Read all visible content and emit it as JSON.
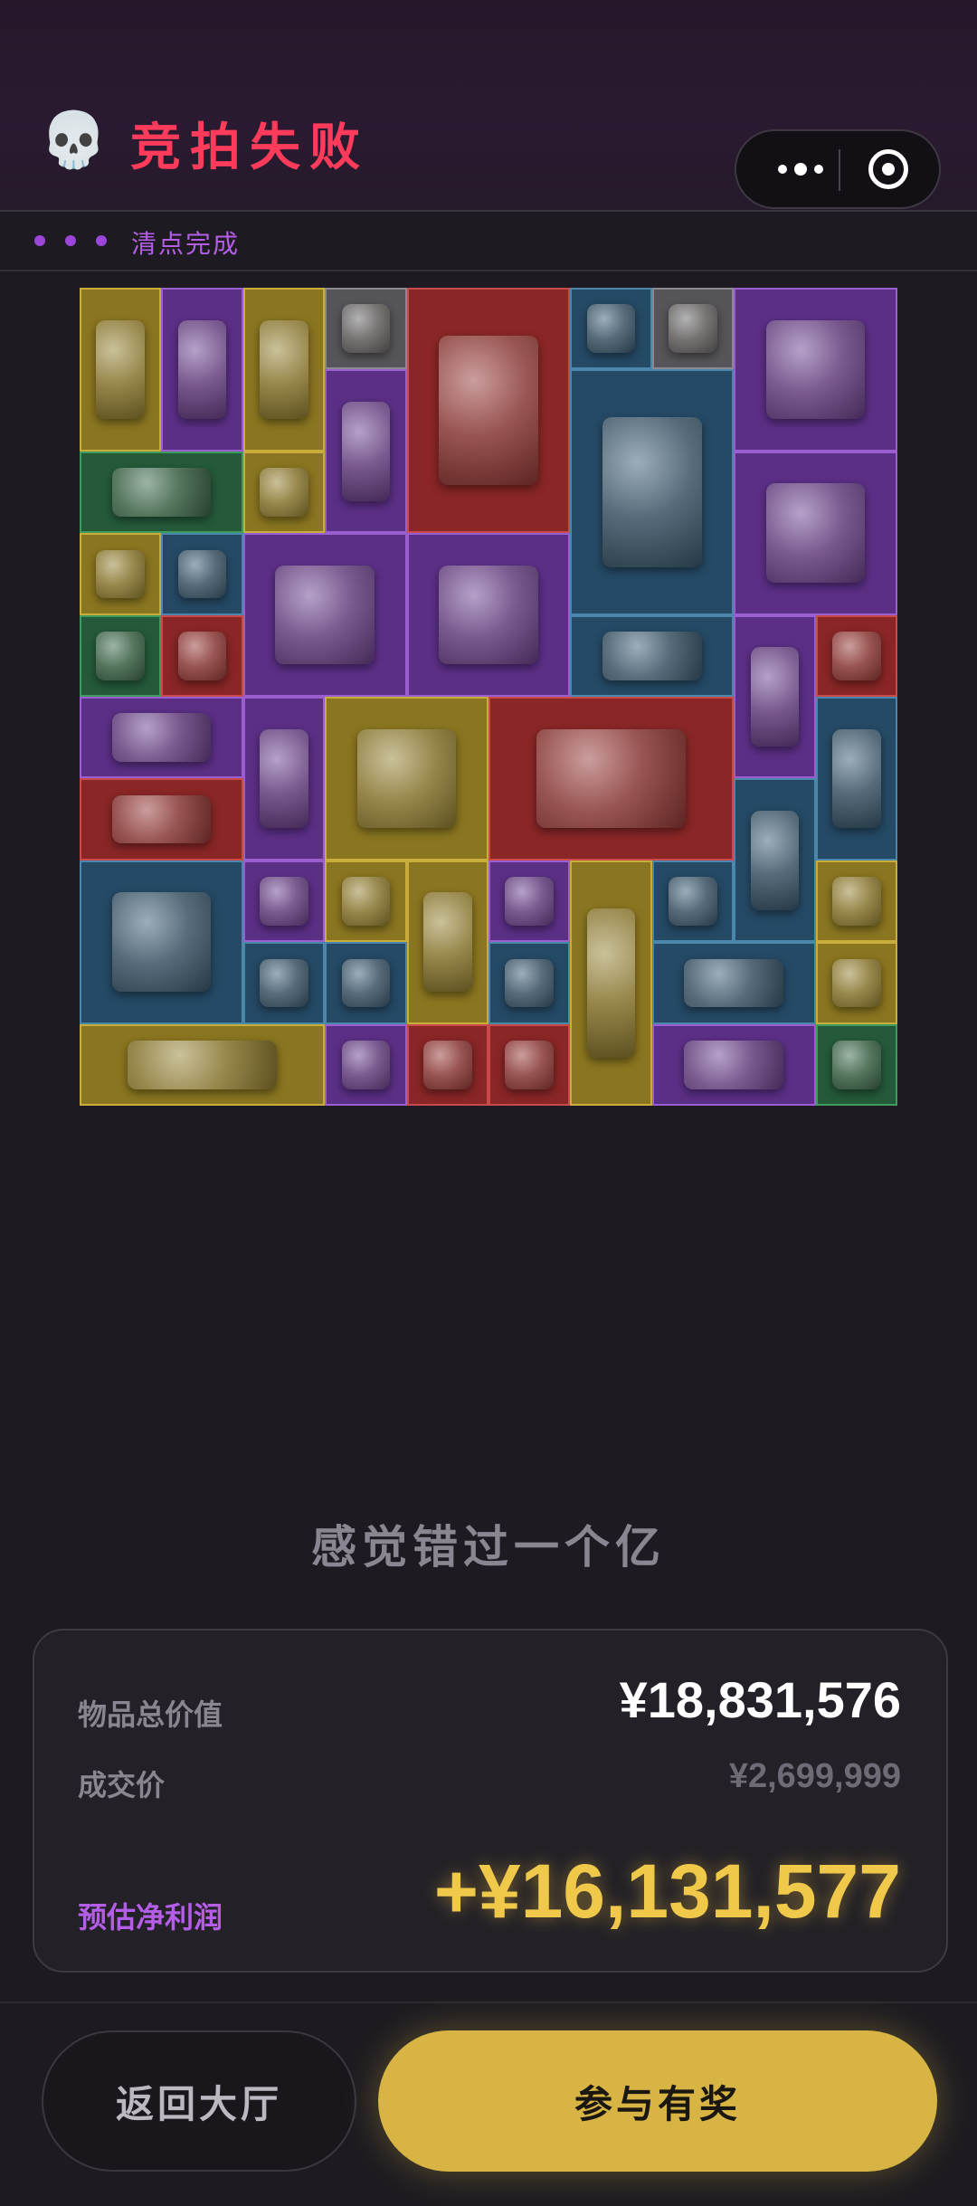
{
  "header": {
    "skull_glyph": "💀",
    "title": "竞拍失败"
  },
  "capsule": {
    "more_icon": "more-dots-icon",
    "close_icon": "target-circle-icon"
  },
  "status": {
    "text": "清点完成"
  },
  "tagline": "感觉错过一个亿",
  "summary": {
    "total_label": "物品总价值",
    "total_value": "¥18,831,576",
    "deal_label": "成交价",
    "deal_value": "¥2,699,999",
    "profit_label": "预估净利润",
    "profit_value": "+¥16,131,577"
  },
  "buttons": {
    "lobby": "返回大厅",
    "join": "参与有奖"
  },
  "colors": {
    "title": "#ff3b5c",
    "accent_purple": "#b45ee8",
    "profit_gold": "#f0c94b",
    "join_button": "#d7b443",
    "rarity_gold": "#8a7620",
    "rarity_purple": "#5b2f86",
    "rarity_blue": "#254a66",
    "rarity_red": "#8a2626",
    "rarity_gray": "#56565a",
    "rarity_green": "#245a3a"
  },
  "items": [
    {
      "name": "item-document",
      "rarity": "gold"
    },
    {
      "name": "item-golden-teapot",
      "rarity": "purple"
    },
    {
      "name": "item-coffee-machine",
      "rarity": "gold"
    },
    {
      "name": "item-playing-card",
      "rarity": "gray"
    },
    {
      "name": "item-gramophone",
      "rarity": "red"
    },
    {
      "name": "item-circuit-chip",
      "rarity": "blue"
    },
    {
      "name": "item-old-letter",
      "rarity": "gray"
    },
    {
      "name": "item-centrifuge",
      "rarity": "purple"
    },
    {
      "name": "item-golden-teapot",
      "rarity": "purple"
    },
    {
      "name": "item-cement-bag",
      "rarity": "blue"
    },
    {
      "name": "item-keyboard",
      "rarity": "green"
    },
    {
      "name": "item-lighter",
      "rarity": "gold"
    },
    {
      "name": "item-circular-saw",
      "rarity": "purple"
    },
    {
      "name": "item-trophy",
      "rarity": "gold"
    },
    {
      "name": "item-power-adapter",
      "rarity": "blue"
    },
    {
      "name": "item-incubator",
      "rarity": "purple"
    },
    {
      "name": "item-centrifuge",
      "rarity": "purple"
    },
    {
      "name": "item-drill",
      "rarity": "blue"
    },
    {
      "name": "item-lantern",
      "rarity": "purple"
    },
    {
      "name": "item-golden-watch",
      "rarity": "red"
    },
    {
      "name": "item-hard-drive",
      "rarity": "green"
    },
    {
      "name": "item-card-reader",
      "rarity": "red"
    },
    {
      "name": "item-radio",
      "rarity": "purple"
    },
    {
      "name": "item-gingerbread",
      "rarity": "purple"
    },
    {
      "name": "item-supply-crate",
      "rarity": "gold"
    },
    {
      "name": "item-server-unit",
      "rarity": "red"
    },
    {
      "name": "item-gunpowder",
      "rarity": "blue"
    },
    {
      "name": "item-graphics-card",
      "rarity": "red"
    },
    {
      "name": "item-ammo-box",
      "rarity": "blue"
    },
    {
      "name": "item-hammer-drill",
      "rarity": "blue"
    },
    {
      "name": "item-pen",
      "rarity": "purple"
    },
    {
      "name": "item-oximeter",
      "rarity": "gold"
    },
    {
      "name": "item-leather-journal",
      "rarity": "gold"
    },
    {
      "name": "item-flashlight",
      "rarity": "purple"
    },
    {
      "name": "item-oxygen-tank",
      "rarity": "gold"
    },
    {
      "name": "item-battery-pack",
      "rarity": "blue"
    },
    {
      "name": "item-medal",
      "rarity": "gold"
    },
    {
      "name": "item-caliper",
      "rarity": "blue"
    },
    {
      "name": "item-thermometer",
      "rarity": "blue"
    },
    {
      "name": "item-metal-plate",
      "rarity": "blue"
    },
    {
      "name": "item-rifle",
      "rarity": "blue"
    },
    {
      "name": "item-multimeter",
      "rarity": "gold"
    },
    {
      "name": "item-tool-case",
      "rarity": "gold"
    },
    {
      "name": "item-gpu-board",
      "rarity": "purple"
    },
    {
      "name": "item-golden-watch",
      "rarity": "red"
    },
    {
      "name": "item-diamond",
      "rarity": "red"
    },
    {
      "name": "item-ssd-package",
      "rarity": "purple"
    },
    {
      "name": "item-circuit-board",
      "rarity": "green"
    }
  ]
}
